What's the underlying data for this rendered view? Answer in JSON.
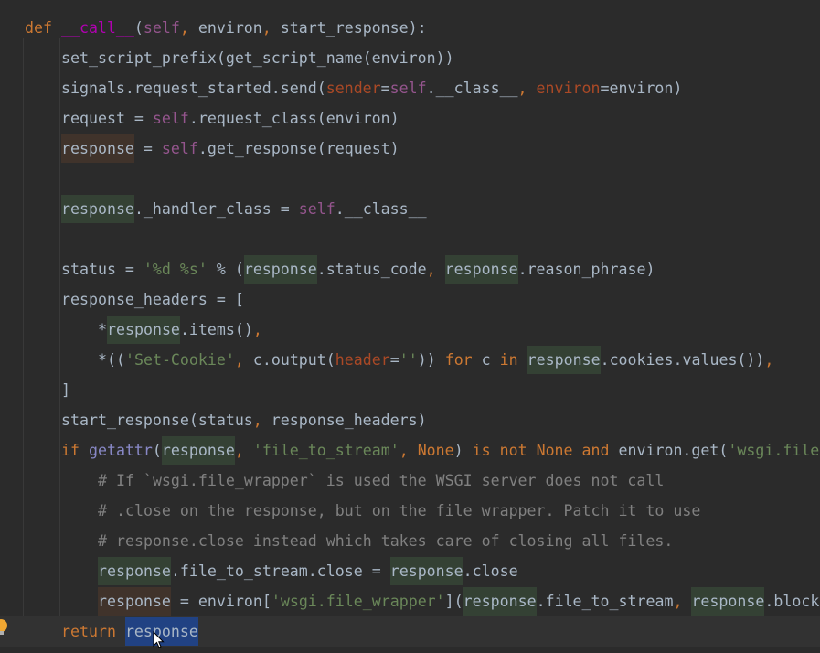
{
  "editor": {
    "current_line": 20,
    "colors": {
      "background": "#2b2b2b",
      "keyword": "#cc7832",
      "self": "#94558d",
      "magic_method": "#b200b2",
      "named_arg": "#aa4926",
      "string": "#6a8759",
      "comment": "#808080",
      "text": "#a9b7c6",
      "read_highlight": "#344134",
      "write_highlight": "#40332b",
      "selection": "#214283"
    },
    "lines": [
      {
        "indent": 0,
        "tokens": [
          [
            "def ",
            "kw"
          ],
          [
            "__call__",
            "fn"
          ],
          [
            "(",
            ""
          ],
          [
            "self",
            "self"
          ],
          [
            ", ",
            "kw"
          ],
          [
            "environ",
            ""
          ],
          [
            ", ",
            "kw"
          ],
          [
            "start_response",
            ""
          ],
          [
            "):",
            ""
          ]
        ]
      },
      {
        "indent": 1,
        "tokens": [
          [
            "set_script_prefix(get_script_name(environ))",
            ""
          ]
        ]
      },
      {
        "indent": 1,
        "tokens": [
          [
            "signals.request_started.send(",
            ""
          ],
          [
            "sender",
            "param"
          ],
          [
            "=",
            ""
          ],
          [
            "self",
            "self"
          ],
          [
            ".__class__",
            ""
          ],
          [
            ", ",
            "kw"
          ],
          [
            "environ",
            "param"
          ],
          [
            "=environ)",
            ""
          ]
        ]
      },
      {
        "indent": 1,
        "tokens": [
          [
            "request = ",
            ""
          ],
          [
            "self",
            "self"
          ],
          [
            ".request_class(environ)",
            ""
          ]
        ]
      },
      {
        "indent": 1,
        "tokens": [
          [
            "response",
            "hb"
          ],
          [
            " = ",
            ""
          ],
          [
            "self",
            "self"
          ],
          [
            ".get_response(request)",
            ""
          ]
        ]
      },
      {
        "indent": 1,
        "tokens": []
      },
      {
        "indent": 1,
        "tokens": [
          [
            "response",
            "hg"
          ],
          [
            "._handler_class = ",
            ""
          ],
          [
            "self",
            "self"
          ],
          [
            ".__class__",
            ""
          ]
        ]
      },
      {
        "indent": 1,
        "tokens": []
      },
      {
        "indent": 1,
        "tokens": [
          [
            "status = ",
            ""
          ],
          [
            "'%d %s'",
            "str"
          ],
          [
            " % (",
            ""
          ],
          [
            "response",
            "hg"
          ],
          [
            ".status_code",
            ""
          ],
          [
            ", ",
            "kw"
          ],
          [
            "response",
            "hg"
          ],
          [
            ".reason_phrase)",
            ""
          ]
        ]
      },
      {
        "indent": 1,
        "tokens": [
          [
            "response_headers = [",
            ""
          ]
        ]
      },
      {
        "indent": 2,
        "tokens": [
          [
            "*",
            ""
          ],
          [
            "response",
            "hg"
          ],
          [
            ".items()",
            ""
          ],
          [
            ",",
            "kw"
          ]
        ]
      },
      {
        "indent": 2,
        "tokens": [
          [
            "*((",
            ""
          ],
          [
            "'Set-Cookie'",
            "str"
          ],
          [
            ", ",
            "kw"
          ],
          [
            "c.output(",
            ""
          ],
          [
            "header",
            "param"
          ],
          [
            "=",
            ""
          ],
          [
            "''",
            "str"
          ],
          [
            ")) ",
            ""
          ],
          [
            "for ",
            "kw"
          ],
          [
            "c ",
            ""
          ],
          [
            "in ",
            "kw"
          ],
          [
            "response",
            "hg"
          ],
          [
            ".cookies.values())",
            ""
          ],
          [
            ",",
            "kw"
          ]
        ]
      },
      {
        "indent": 1,
        "tokens": [
          [
            "]",
            ""
          ]
        ]
      },
      {
        "indent": 1,
        "tokens": [
          [
            "start_response(status",
            ""
          ],
          [
            ", ",
            "kw"
          ],
          [
            "response_headers)",
            ""
          ]
        ]
      },
      {
        "indent": 1,
        "tokens": [
          [
            "if ",
            "kw"
          ],
          [
            "getattr",
            "bi"
          ],
          [
            "(",
            ""
          ],
          [
            "response",
            "hg"
          ],
          [
            ", ",
            "kw"
          ],
          [
            "'file_to_stream'",
            "str"
          ],
          [
            ", ",
            "kw"
          ],
          [
            "None",
            "kw"
          ],
          [
            ") ",
            ""
          ],
          [
            "is not None and ",
            "kw"
          ],
          [
            "environ.get(",
            ""
          ],
          [
            "'wsgi.file",
            "str"
          ]
        ]
      },
      {
        "indent": 2,
        "tokens": [
          [
            "# If `wsgi.file_wrapper` is used the WSGI server does not call",
            "cmt"
          ]
        ]
      },
      {
        "indent": 2,
        "tokens": [
          [
            "# .close on the response, but on the file wrapper. Patch it to use",
            "cmt"
          ]
        ]
      },
      {
        "indent": 2,
        "tokens": [
          [
            "# response.close instead which takes care of closing all files.",
            "cmt"
          ]
        ]
      },
      {
        "indent": 2,
        "tokens": [
          [
            "response",
            "hg"
          ],
          [
            ".file_to_stream.close = ",
            ""
          ],
          [
            "response",
            "hg"
          ],
          [
            ".close",
            ""
          ]
        ]
      },
      {
        "indent": 2,
        "tokens": [
          [
            "response",
            "hb"
          ],
          [
            " = environ[",
            ""
          ],
          [
            "'wsgi.file_wrapper'",
            "str"
          ],
          [
            "](",
            ""
          ],
          [
            "response",
            "hg"
          ],
          [
            ".file_to_stream",
            ""
          ],
          [
            ", ",
            "kw"
          ],
          [
            "response",
            "hg"
          ],
          [
            ".block",
            ""
          ]
        ]
      },
      {
        "indent": 1,
        "tokens": [
          [
            "return ",
            "kw"
          ],
          [
            "response",
            "sel"
          ]
        ]
      }
    ]
  },
  "gutter": {
    "icon": "lightbulb-icon"
  },
  "pointer": {
    "icon": "mouse-cursor-icon"
  }
}
